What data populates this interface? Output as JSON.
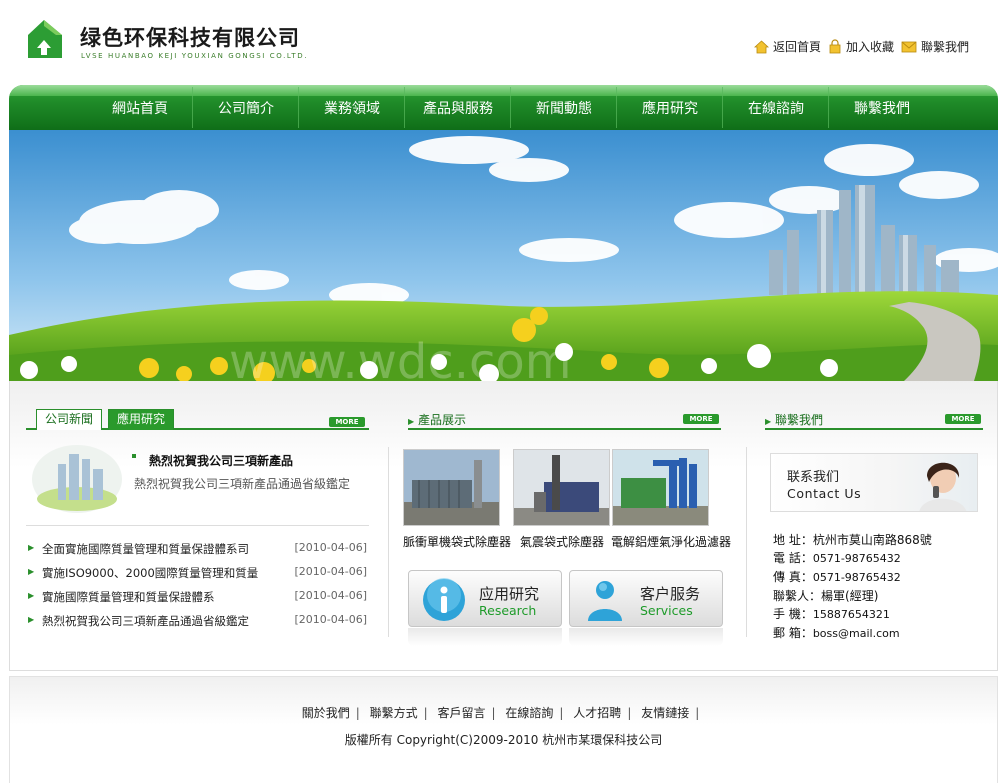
{
  "header": {
    "company_name": "绿色环保科技有限公司",
    "company_pinyin": "LVSE HUANBAO KEJI YOUXIAN GONGSI CO.LTD.",
    "top_links": [
      {
        "label": "返回首頁",
        "icon": "home-icon"
      },
      {
        "label": "加入收藏",
        "icon": "lock-icon"
      },
      {
        "label": "聯繫我們",
        "icon": "envelope-icon"
      }
    ]
  },
  "nav": {
    "items": [
      "網站首頁",
      "公司簡介",
      "業務領域",
      "產品與服務",
      "新聞動態",
      "應用研究",
      "在線諮詢",
      "聯繫我們"
    ]
  },
  "banner": {
    "watermark": "www.wdc.com"
  },
  "news": {
    "tabs": [
      "公司新聞",
      "應用研究"
    ],
    "more_label": "MORE",
    "featured": {
      "title": "熱烈祝賀我公司三項新產品",
      "desc": "熱烈祝賀我公司三項新產品通過省級鑑定"
    },
    "items": [
      {
        "title": "全面實施國際質量管理和質量保證體系司",
        "date": "[2010-04-06]"
      },
      {
        "title": "實施ISO9000、2000國際質量管理和質量",
        "date": "[2010-04-06]"
      },
      {
        "title": "實施國際質量管理和質量保證體系",
        "date": "[2010-04-06]"
      },
      {
        "title": "熱烈祝賀我公司三項新產品通過省級鑑定",
        "date": "[2010-04-06]"
      }
    ]
  },
  "products": {
    "heading": "產品展示",
    "more_label": "MORE",
    "items": [
      {
        "caption": "脈衝單機袋式除塵器"
      },
      {
        "caption": "氣震袋式除塵器"
      },
      {
        "caption": "電解鋁煙氣淨化過濾器"
      }
    ]
  },
  "services": [
    {
      "cn": "应用研究",
      "en": "Research",
      "icon": "info-icon"
    },
    {
      "cn": "客户服务",
      "en": "Services",
      "icon": "person-icon"
    }
  ],
  "contact": {
    "heading": "聯繫我們",
    "more_label": "MORE",
    "banner_cn": "联系我们",
    "banner_en": "Contact Us",
    "rows": [
      {
        "label": "地  址：",
        "value": "杭州市莫山南路868號"
      },
      {
        "label": "電  話：",
        "value": "0571-98765432"
      },
      {
        "label": "傳  真：",
        "value": "0571-98765432"
      },
      {
        "label": "聯繫人：",
        "value": "楊軍(經理)"
      },
      {
        "label": "手  機：",
        "value": "15887654321"
      },
      {
        "label": "郵  箱：",
        "value": "boss@mail.com"
      }
    ]
  },
  "footer": {
    "links": [
      "關於我們",
      "聯繫方式",
      "客戶留言",
      "在線諮詢",
      "人才招聘",
      "友情鏈接"
    ],
    "separator": "|",
    "copyright": "版權所有 Copyright(C)2009-2010 杭州市某環保科技公司"
  },
  "colors": {
    "brand_green": "#2a8f2c",
    "nav_green": "#1f8a28",
    "service_en": "#1e9b2a"
  }
}
